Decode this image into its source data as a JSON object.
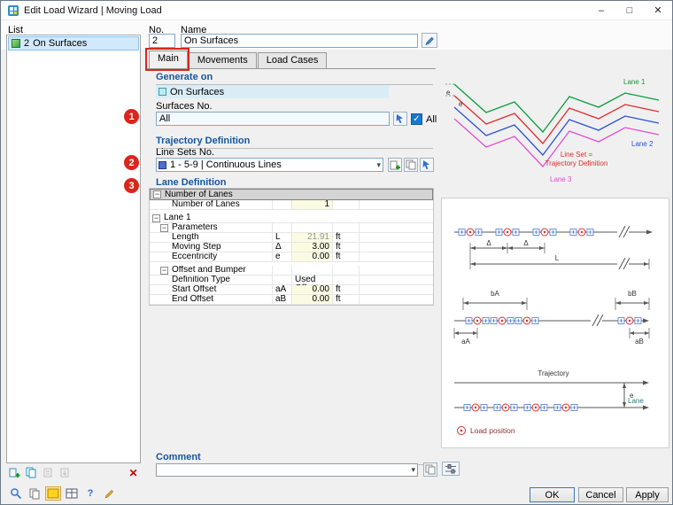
{
  "window": {
    "title": "Edit Load Wizard | Moving Load"
  },
  "icons": {
    "minimize": "–",
    "maximize": "□",
    "close": "✕",
    "chevron": "▾",
    "check": "✓",
    "collapse": "−",
    "delete_x": "✕",
    "question": "?"
  },
  "list_panel": {
    "label": "List",
    "item_no": "2",
    "item_label": "On Surfaces"
  },
  "header": {
    "no_label": "No.",
    "no_value": "2",
    "name_label": "Name",
    "name_value": "On Surfaces"
  },
  "tabs": {
    "main": "Main",
    "movements": "Movements",
    "load_cases": "Load Cases"
  },
  "sections": {
    "generate_on": {
      "title": "Generate on",
      "value": "On Surfaces"
    },
    "surfaces": {
      "label": "Surfaces No.",
      "value": "All",
      "all_label": "All"
    },
    "trajectory": {
      "title": "Trajectory Definition",
      "label": "Line Sets No.",
      "value": "1 - 5-9 | Continuous Lines"
    },
    "lane": {
      "title": "Lane Definition"
    },
    "comment": {
      "title": "Comment"
    }
  },
  "lane_table": {
    "rows": [
      {
        "label": "Number of Lanes"
      },
      {
        "label": "Number of Lanes",
        "value": "1"
      },
      {
        "label": "Lane 1"
      },
      {
        "label": "Parameters"
      },
      {
        "label": "Length",
        "sym": "L",
        "value": "21.91",
        "unit": "ft"
      },
      {
        "label": "Moving Step",
        "sym": "Δ",
        "value": "3.00",
        "unit": "ft"
      },
      {
        "label": "Eccentricity",
        "sym": "e",
        "value": "0.00",
        "unit": "ft"
      },
      {
        "label": "Offset and Bumper"
      },
      {
        "label": "Definition Type",
        "value": "Used Offset"
      },
      {
        "label": "Start Offset",
        "sym": "aA",
        "value": "0.00",
        "unit": "ft"
      },
      {
        "label": "End Offset",
        "sym": "aB",
        "value": "0.00",
        "unit": "ft"
      }
    ]
  },
  "annotations": {
    "s1": "1",
    "s2": "2",
    "s3": "3"
  },
  "diagram": {
    "lane1": "Lane 1",
    "line_set_1": "Line Set =",
    "line_set_2": "Trajectory Definition",
    "lane2": "Lane 2",
    "lane3": "Lane 3",
    "e": "e",
    "delta": "Δ",
    "L": "L",
    "bA": "bA",
    "bB": "bB",
    "aA": "aA",
    "aB": "aB",
    "trajectory": "Trajectory",
    "lane": "Lane",
    "legend": "Load position"
  },
  "colors": {
    "annotation_red": "#d9261c",
    "lane1_green": "#089e3c",
    "lineset_red": "#dd2c2c",
    "lane2_blue": "#2d4fd0",
    "lane3_magenta": "#df4fd0",
    "selection_blue": "#d2e9fc"
  },
  "footer": {
    "ok": "OK",
    "cancel": "Cancel",
    "apply": "Apply"
  }
}
